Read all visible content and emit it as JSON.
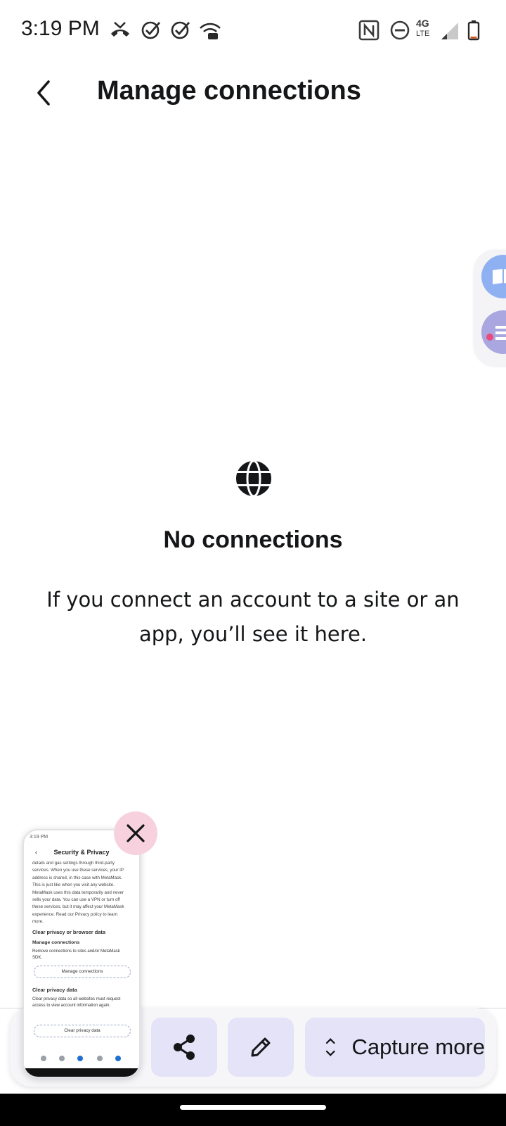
{
  "status_bar": {
    "time": "3:19 PM",
    "icons": [
      "missed-call-icon",
      "check-circle-icon",
      "check-circle-icon",
      "wifi-calling-icon",
      "nfc-icon",
      "do-not-disturb-icon",
      "network-4g-lte-icon",
      "signal-icon",
      "battery-icon"
    ],
    "network_label_top": "4G",
    "network_label_bottom": "LTE"
  },
  "header": {
    "back_icon": "chevron-left-icon",
    "title": "Manage connections"
  },
  "empty_state": {
    "icon": "globe-icon",
    "title": "No connections",
    "description": "If you connect an account to a site or an app, you’ll see it here."
  },
  "edge_panel": {
    "apps": [
      "book-app-icon",
      "notes-app-icon"
    ],
    "colors": [
      "#8fb1f2",
      "#a9a6e0"
    ]
  },
  "screenshot_preview": {
    "status_time": "3:19 PM",
    "title": "Security & Privacy",
    "body_text": "details and gas settings through third-party services. When you use these services, your IP address is shared, in this case with MetaMask. This is just like when you visit any website. MetaMask uses this data temporarily and never sells your data. You can use a VPN or turn off these services, but it may affect your MetaMask experience. Read our Privacy policy to learn more.",
    "section_heading": "Clear privacy or browser data",
    "manage_heading": "Manage connections",
    "manage_desc": "Remove connections to sites and/or MetaMask SDK.",
    "manage_button": "Manage connections",
    "clear_heading": "Clear privacy data",
    "clear_desc": "Clear privacy data so all websites must request access to view account information again.",
    "clear_button": "Clear privacy data",
    "close_icon": "close-icon"
  },
  "capture_toolbar": {
    "share_icon": "share-icon",
    "edit_icon": "pencil-icon",
    "capture_icon": "expand-vertical-icon",
    "capture_label": "Capture more"
  },
  "colors": {
    "accent_button": "#e4e3f8",
    "close_button": "#f7d2de",
    "text": "#141618"
  }
}
